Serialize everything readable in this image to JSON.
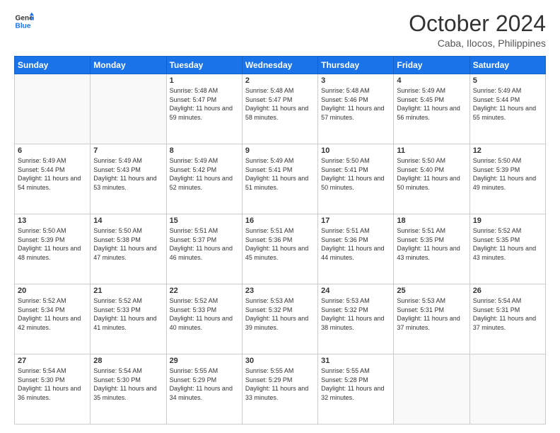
{
  "header": {
    "logo_line1": "General",
    "logo_line2": "Blue",
    "month": "October 2024",
    "location": "Caba, Ilocos, Philippines"
  },
  "weekdays": [
    "Sunday",
    "Monday",
    "Tuesday",
    "Wednesday",
    "Thursday",
    "Friday",
    "Saturday"
  ],
  "weeks": [
    [
      {
        "day": "",
        "sunrise": "",
        "sunset": "",
        "daylight": ""
      },
      {
        "day": "",
        "sunrise": "",
        "sunset": "",
        "daylight": ""
      },
      {
        "day": "1",
        "sunrise": "Sunrise: 5:48 AM",
        "sunset": "Sunset: 5:47 PM",
        "daylight": "Daylight: 11 hours and 59 minutes."
      },
      {
        "day": "2",
        "sunrise": "Sunrise: 5:48 AM",
        "sunset": "Sunset: 5:47 PM",
        "daylight": "Daylight: 11 hours and 58 minutes."
      },
      {
        "day": "3",
        "sunrise": "Sunrise: 5:48 AM",
        "sunset": "Sunset: 5:46 PM",
        "daylight": "Daylight: 11 hours and 57 minutes."
      },
      {
        "day": "4",
        "sunrise": "Sunrise: 5:49 AM",
        "sunset": "Sunset: 5:45 PM",
        "daylight": "Daylight: 11 hours and 56 minutes."
      },
      {
        "day": "5",
        "sunrise": "Sunrise: 5:49 AM",
        "sunset": "Sunset: 5:44 PM",
        "daylight": "Daylight: 11 hours and 55 minutes."
      }
    ],
    [
      {
        "day": "6",
        "sunrise": "Sunrise: 5:49 AM",
        "sunset": "Sunset: 5:44 PM",
        "daylight": "Daylight: 11 hours and 54 minutes."
      },
      {
        "day": "7",
        "sunrise": "Sunrise: 5:49 AM",
        "sunset": "Sunset: 5:43 PM",
        "daylight": "Daylight: 11 hours and 53 minutes."
      },
      {
        "day": "8",
        "sunrise": "Sunrise: 5:49 AM",
        "sunset": "Sunset: 5:42 PM",
        "daylight": "Daylight: 11 hours and 52 minutes."
      },
      {
        "day": "9",
        "sunrise": "Sunrise: 5:49 AM",
        "sunset": "Sunset: 5:41 PM",
        "daylight": "Daylight: 11 hours and 51 minutes."
      },
      {
        "day": "10",
        "sunrise": "Sunrise: 5:50 AM",
        "sunset": "Sunset: 5:41 PM",
        "daylight": "Daylight: 11 hours and 50 minutes."
      },
      {
        "day": "11",
        "sunrise": "Sunrise: 5:50 AM",
        "sunset": "Sunset: 5:40 PM",
        "daylight": "Daylight: 11 hours and 50 minutes."
      },
      {
        "day": "12",
        "sunrise": "Sunrise: 5:50 AM",
        "sunset": "Sunset: 5:39 PM",
        "daylight": "Daylight: 11 hours and 49 minutes."
      }
    ],
    [
      {
        "day": "13",
        "sunrise": "Sunrise: 5:50 AM",
        "sunset": "Sunset: 5:39 PM",
        "daylight": "Daylight: 11 hours and 48 minutes."
      },
      {
        "day": "14",
        "sunrise": "Sunrise: 5:50 AM",
        "sunset": "Sunset: 5:38 PM",
        "daylight": "Daylight: 11 hours and 47 minutes."
      },
      {
        "day": "15",
        "sunrise": "Sunrise: 5:51 AM",
        "sunset": "Sunset: 5:37 PM",
        "daylight": "Daylight: 11 hours and 46 minutes."
      },
      {
        "day": "16",
        "sunrise": "Sunrise: 5:51 AM",
        "sunset": "Sunset: 5:36 PM",
        "daylight": "Daylight: 11 hours and 45 minutes."
      },
      {
        "day": "17",
        "sunrise": "Sunrise: 5:51 AM",
        "sunset": "Sunset: 5:36 PM",
        "daylight": "Daylight: 11 hours and 44 minutes."
      },
      {
        "day": "18",
        "sunrise": "Sunrise: 5:51 AM",
        "sunset": "Sunset: 5:35 PM",
        "daylight": "Daylight: 11 hours and 43 minutes."
      },
      {
        "day": "19",
        "sunrise": "Sunrise: 5:52 AM",
        "sunset": "Sunset: 5:35 PM",
        "daylight": "Daylight: 11 hours and 43 minutes."
      }
    ],
    [
      {
        "day": "20",
        "sunrise": "Sunrise: 5:52 AM",
        "sunset": "Sunset: 5:34 PM",
        "daylight": "Daylight: 11 hours and 42 minutes."
      },
      {
        "day": "21",
        "sunrise": "Sunrise: 5:52 AM",
        "sunset": "Sunset: 5:33 PM",
        "daylight": "Daylight: 11 hours and 41 minutes."
      },
      {
        "day": "22",
        "sunrise": "Sunrise: 5:52 AM",
        "sunset": "Sunset: 5:33 PM",
        "daylight": "Daylight: 11 hours and 40 minutes."
      },
      {
        "day": "23",
        "sunrise": "Sunrise: 5:53 AM",
        "sunset": "Sunset: 5:32 PM",
        "daylight": "Daylight: 11 hours and 39 minutes."
      },
      {
        "day": "24",
        "sunrise": "Sunrise: 5:53 AM",
        "sunset": "Sunset: 5:32 PM",
        "daylight": "Daylight: 11 hours and 38 minutes."
      },
      {
        "day": "25",
        "sunrise": "Sunrise: 5:53 AM",
        "sunset": "Sunset: 5:31 PM",
        "daylight": "Daylight: 11 hours and 37 minutes."
      },
      {
        "day": "26",
        "sunrise": "Sunrise: 5:54 AM",
        "sunset": "Sunset: 5:31 PM",
        "daylight": "Daylight: 11 hours and 37 minutes."
      }
    ],
    [
      {
        "day": "27",
        "sunrise": "Sunrise: 5:54 AM",
        "sunset": "Sunset: 5:30 PM",
        "daylight": "Daylight: 11 hours and 36 minutes."
      },
      {
        "day": "28",
        "sunrise": "Sunrise: 5:54 AM",
        "sunset": "Sunset: 5:30 PM",
        "daylight": "Daylight: 11 hours and 35 minutes."
      },
      {
        "day": "29",
        "sunrise": "Sunrise: 5:55 AM",
        "sunset": "Sunset: 5:29 PM",
        "daylight": "Daylight: 11 hours and 34 minutes."
      },
      {
        "day": "30",
        "sunrise": "Sunrise: 5:55 AM",
        "sunset": "Sunset: 5:29 PM",
        "daylight": "Daylight: 11 hours and 33 minutes."
      },
      {
        "day": "31",
        "sunrise": "Sunrise: 5:55 AM",
        "sunset": "Sunset: 5:28 PM",
        "daylight": "Daylight: 11 hours and 32 minutes."
      },
      {
        "day": "",
        "sunrise": "",
        "sunset": "",
        "daylight": ""
      },
      {
        "day": "",
        "sunrise": "",
        "sunset": "",
        "daylight": ""
      }
    ]
  ]
}
